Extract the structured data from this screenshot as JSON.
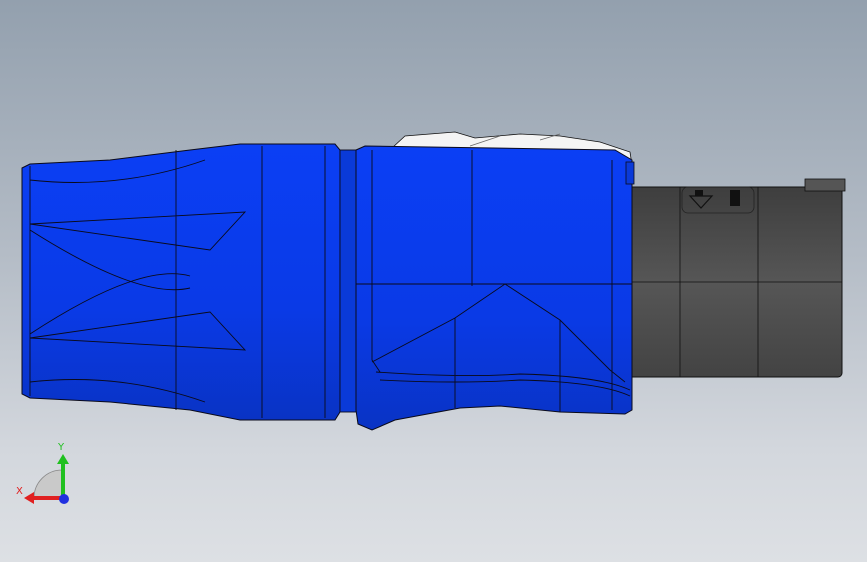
{
  "viewport": {
    "name": "3D model view",
    "background_top": "#93a0ae",
    "background_bottom": "#dde0e4"
  },
  "model": {
    "body_color": "#0b3ff5",
    "body_shade": "#0835c9",
    "edge_color": "#0a0a1a",
    "rear_color": "#4b4b4b",
    "white_part_color": "#f4f4f4"
  },
  "triad": {
    "x_label": "X",
    "y_label": "Y",
    "x_color": "#e02020",
    "y_color": "#20c020",
    "z_color": "#2030e0"
  }
}
